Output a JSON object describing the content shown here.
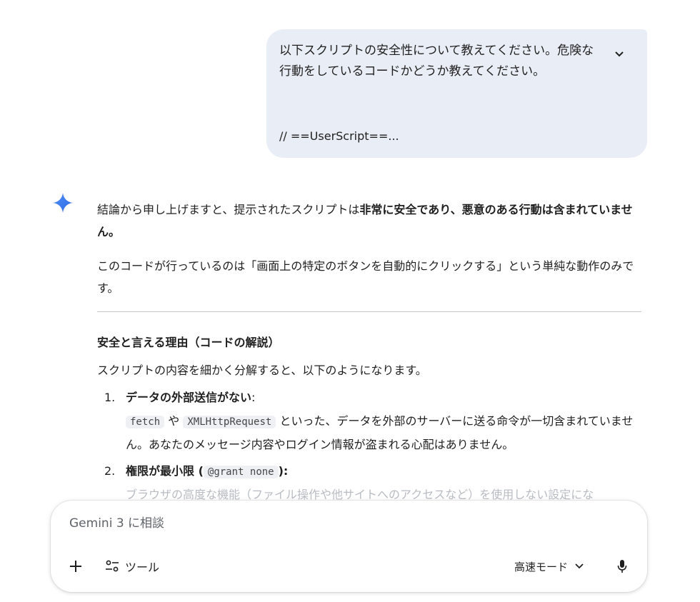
{
  "user_message": {
    "text": "以下スクリプトの安全性について教えてください。危険な行動をしているコードかどうか教えてください。",
    "code_preview": "// ==UserScript==..."
  },
  "response": {
    "p1_before": "結論から申し上げますと、提示されたスクリプトは",
    "p1_bold": "非常に安全であり、悪意のある行動は含まれていません。",
    "p2": "このコードが行っているのは「画面上の特定のボタンを自動的にクリックする」という単純な動作のみです。",
    "heading": "安全と言える理由（コードの解説）",
    "p3": "スクリプトの内容を細かく分解すると、以下のようになります。",
    "items": [
      {
        "num": "1.",
        "head_bold": "データの外部送信がない",
        "head_suffix": ":",
        "code1": "fetch",
        "mid": " や ",
        "code2": "XMLHttpRequest",
        "body": " といった、データを外部のサーバーに送る命令が一切含まれていません。あなたのメッセージ内容やログイン情報が盗まれる心配はありません。"
      },
      {
        "num": "2.",
        "head_bold": "権限が最小限 (",
        "head_code": "@grant none",
        "head_suffix": "):",
        "body": "ブラウザの高度な機能（ファイル操作や他サイトへのアクセスなど）を使用しない設定にな"
      }
    ]
  },
  "composer": {
    "placeholder": "Gemini 3 に相談",
    "tools_label": "ツール",
    "mode_label": "高速モード"
  },
  "icons": {
    "expand": "chevron-down-icon",
    "logo": "gemini-spark-icon",
    "plus": "plus-icon",
    "tools": "tools-sliders-icon",
    "mode": "chevron-down-icon",
    "mic": "microphone-icon"
  },
  "colors": {
    "user_bubble": "#e9eef6",
    "logo_blue": "#4285f4"
  }
}
